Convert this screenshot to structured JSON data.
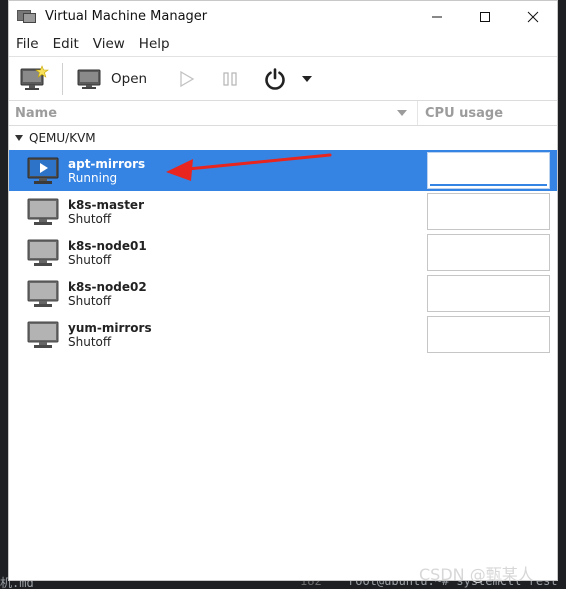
{
  "window": {
    "title": "Virtual Machine Manager",
    "controls": {
      "minimize": "—",
      "maximize": "☐",
      "close": "✕"
    }
  },
  "menu": [
    "File",
    "Edit",
    "View",
    "Help"
  ],
  "toolbar": {
    "new_vm_icon": "monitor-star-icon",
    "open_label": "Open",
    "run_icon": "play-icon",
    "pause_icon": "pause-icon",
    "shutdown_icon": "power-icon",
    "shutdown_menu_icon": "caret-down-icon"
  },
  "columns": {
    "name": "Name",
    "cpu": "CPU usage"
  },
  "connection": {
    "label": "QEMU/KVM"
  },
  "vms": [
    {
      "name": "apt-mirrors",
      "status": "Running",
      "selected": true
    },
    {
      "name": "k8s-master",
      "status": "Shutoff",
      "selected": false
    },
    {
      "name": "k8s-node01",
      "status": "Shutoff",
      "selected": false
    },
    {
      "name": "k8s-node02",
      "status": "Shutoff",
      "selected": false
    },
    {
      "name": "yum-mirrors",
      "status": "Shutoff",
      "selected": false
    }
  ],
  "background": {
    "terminal_text": "root@ubuntu:~# systemctl rest",
    "line_number": "182",
    "file_fragment": "机.md"
  },
  "watermark": "CSDN @甄某人",
  "colors": {
    "selection": "#3584e4",
    "annotation_arrow": "#e8251f"
  }
}
